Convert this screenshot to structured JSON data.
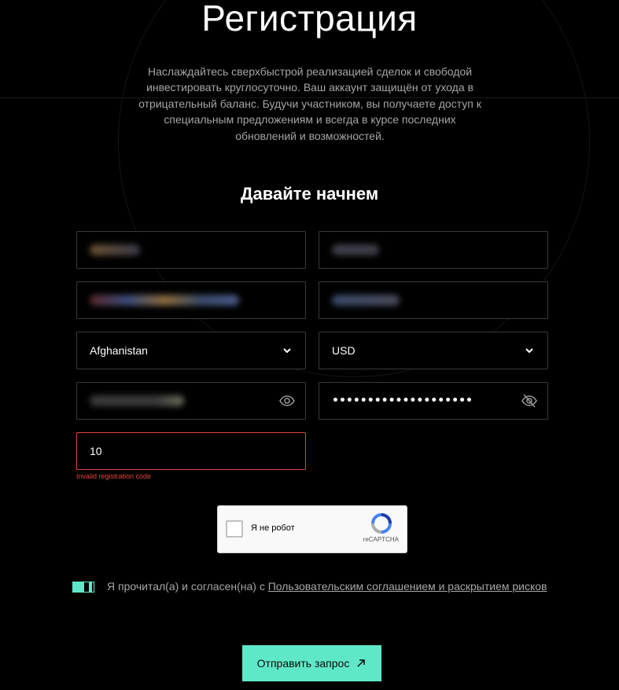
{
  "page": {
    "title": "Регистрация",
    "intro": "Наслаждайтесь сверхбыстрой реализацией сделок и свободой инвестировать круглосуточно. Ваш аккаунт защищён от ухода в отрицательный баланс. Будучи участником, вы получаете доступ к специальным предложениям и всегда в курсе последних обновлений и возможностей.",
    "subtitle": "Давайте начнем"
  },
  "form": {
    "country_value": "Afghanistan",
    "currency_value": "USD",
    "password_masked": "••••••••••••••••••••",
    "registration_code_value": "10",
    "registration_code_error": "Invalid registration code"
  },
  "captcha": {
    "label": "Я не робот",
    "brand": "reCAPTCHA"
  },
  "agreement": {
    "text": "Я прочитал(а) и согласен(на) с ",
    "link": "Пользовательским соглашением и раскрытием рисков"
  },
  "submit": {
    "label": "Отправить запрос"
  },
  "colors": {
    "accent": "#5fe8c8",
    "error": "#e0463a",
    "background": "#000000"
  }
}
